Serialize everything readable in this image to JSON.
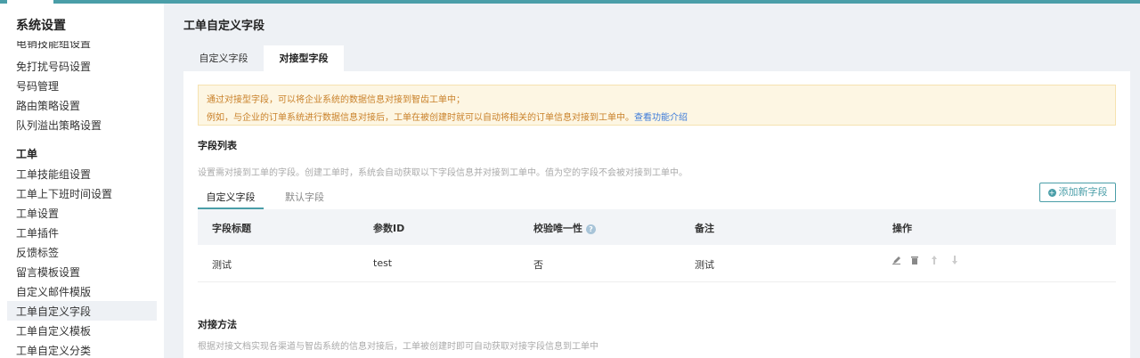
{
  "sidebar": {
    "title": "系统设置",
    "clipped_item": "电销技能组设置",
    "items_top": [
      "免打扰号码设置",
      "号码管理",
      "路由策略设置",
      "队列溢出策略设置"
    ],
    "section": "工单",
    "items_ticket": [
      "工单技能组设置",
      "工单上下班时间设置",
      "工单设置",
      "工单插件",
      "反馈标签",
      "留言模板设置",
      "自定义邮件模版",
      "工单自定义字段",
      "工单自定义模板",
      "工单自定义分类"
    ],
    "active_item": "工单自定义字段"
  },
  "header": {
    "title": "工单自定义字段"
  },
  "tabs": {
    "custom": "自定义字段",
    "docking": "对接型字段",
    "active": "对接型字段"
  },
  "notice": {
    "line1": "通过对接型字段，可以将企业系统的数据信息对接到智齿工单中；",
    "line2": "例如，与企业的订单系统进行数据信息对接后，工单在被创建时就可以自动将相关的订单信息对接到工单中。",
    "link": "查看功能介绍"
  },
  "field_list": {
    "title": "字段列表",
    "desc": "设置需对接到工单的字段。创建工单时，系统会自动获取以下字段信息并对接到工单中。值为空的字段不会被对接到工单中。",
    "subtabs": {
      "custom": "自定义字段",
      "default": "默认字段"
    },
    "add_button": "添加新字段",
    "columns": [
      "字段标题",
      "参数ID",
      "校验唯一性",
      "备注",
      "操作"
    ],
    "rows": [
      {
        "title": "测试",
        "param_id": "test",
        "unique": "否",
        "remark": "测试"
      }
    ]
  },
  "method": {
    "title": "对接方法",
    "desc": "根据对接文档实现各渠道与智齿系统的信息对接后，工单被创建时即可自动获取对接字段信息到工单中"
  },
  "icons": {
    "edit": "edit-icon",
    "delete": "trash-icon",
    "up": "arrow-up-icon",
    "down": "arrow-down-icon",
    "help": "question-icon",
    "add": "plus-circle-icon"
  },
  "colors": {
    "accent": "#4a9ea8",
    "notice_text": "#c9812a",
    "link": "#3d7bd9"
  }
}
